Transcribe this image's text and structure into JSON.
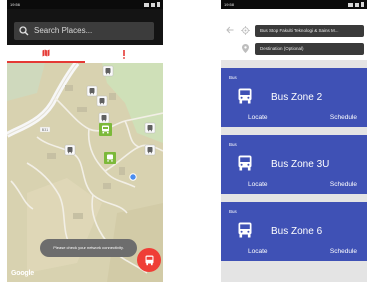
{
  "left_screen": {
    "status_time": "19:56",
    "search_placeholder": "Search Places...",
    "tabs": [
      {
        "icon": "map-icon",
        "active": true
      },
      {
        "icon": "alert-icon",
        "active": false
      }
    ],
    "map_road_label": "B31",
    "toast": "Please check your network connectivity.",
    "map_attribution": "Google",
    "fab_icon": "bus-icon",
    "colors": {
      "accent": "#ef3e36",
      "toolbar": "#141414",
      "toast": "#6d6d6d",
      "marker_green": "#7cb93a"
    }
  },
  "right_screen": {
    "status_time": "19:58",
    "origin_value": "Bus Stop Fakulti Teknologi & Sains M...",
    "destination_placeholder": "Destination (Optional)",
    "cards": [
      {
        "category": "Bus",
        "name": "Bus Zone 2",
        "locate": "Locate",
        "schedule": "Schedule"
      },
      {
        "category": "Bus",
        "name": "Bus Zone 3U",
        "locate": "Locate",
        "schedule": "Schedule"
      },
      {
        "category": "Bus",
        "name": "Bus Zone 6",
        "locate": "Locate",
        "schedule": "Schedule"
      }
    ],
    "colors": {
      "card": "#3f51b5",
      "background": "#e4e4e4"
    }
  }
}
